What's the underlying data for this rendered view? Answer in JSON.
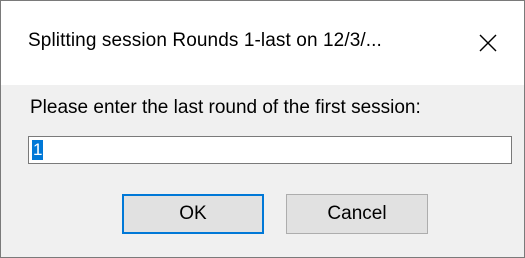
{
  "window": {
    "title": "Splitting session Rounds 1-last on 12/3/...",
    "close_icon": "close-icon"
  },
  "prompt": {
    "label": "Please enter the last round of the first session:"
  },
  "input": {
    "value": "1"
  },
  "buttons": {
    "ok_label": "OK",
    "cancel_label": "Cancel"
  },
  "colors": {
    "accent": "#0078d7",
    "dialog_bg": "#f0f0f0",
    "button_bg": "#e1e1e1"
  }
}
